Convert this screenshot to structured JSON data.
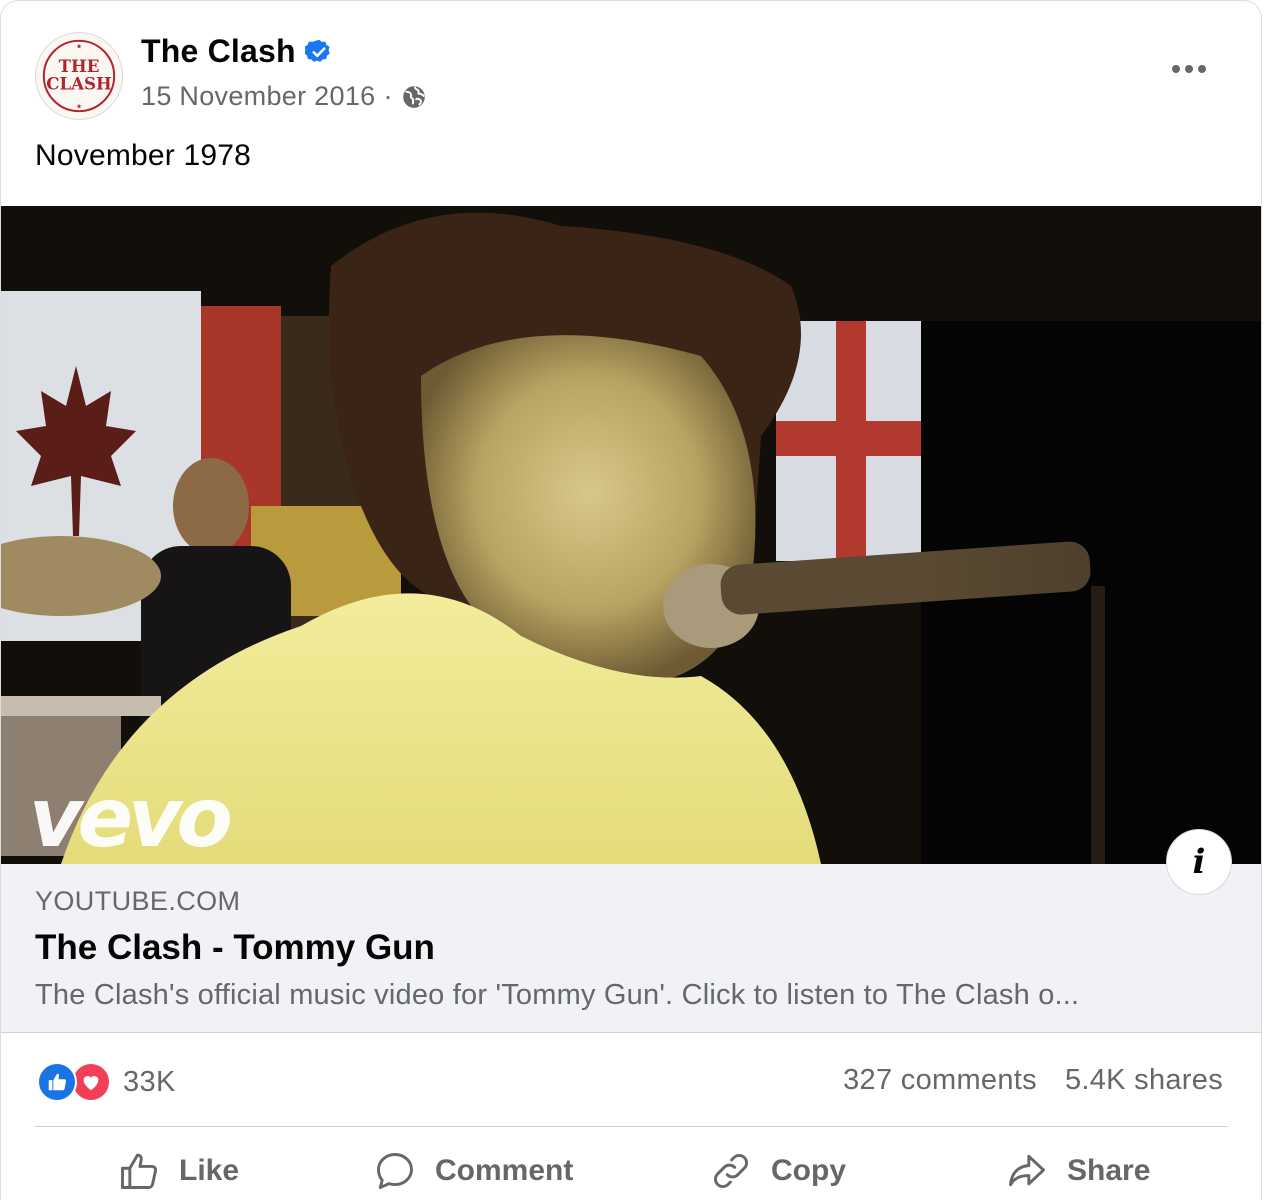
{
  "post": {
    "page_name": "The Clash",
    "date": "15 November 2016",
    "separator": "·",
    "privacy_icon": "globe-icon",
    "text": "November 1978",
    "avatar_text": "THE CLASH"
  },
  "media": {
    "watermark": "vevo"
  },
  "link_preview": {
    "domain": "YOUTUBE.COM",
    "title": "The Clash - Tommy Gun",
    "description": "The Clash's official music video for 'Tommy Gun'. Click to listen to The Clash o..."
  },
  "stats": {
    "reactions_count": "33K",
    "comments": "327 comments",
    "shares": "5.4K shares"
  },
  "actions": {
    "like": "Like",
    "comment": "Comment",
    "copy": "Copy",
    "share": "Share"
  },
  "colors": {
    "accent": "#1b74e4",
    "love": "#f33e58",
    "secondary_text": "#65676b",
    "link_bg": "#f0f2f5"
  }
}
